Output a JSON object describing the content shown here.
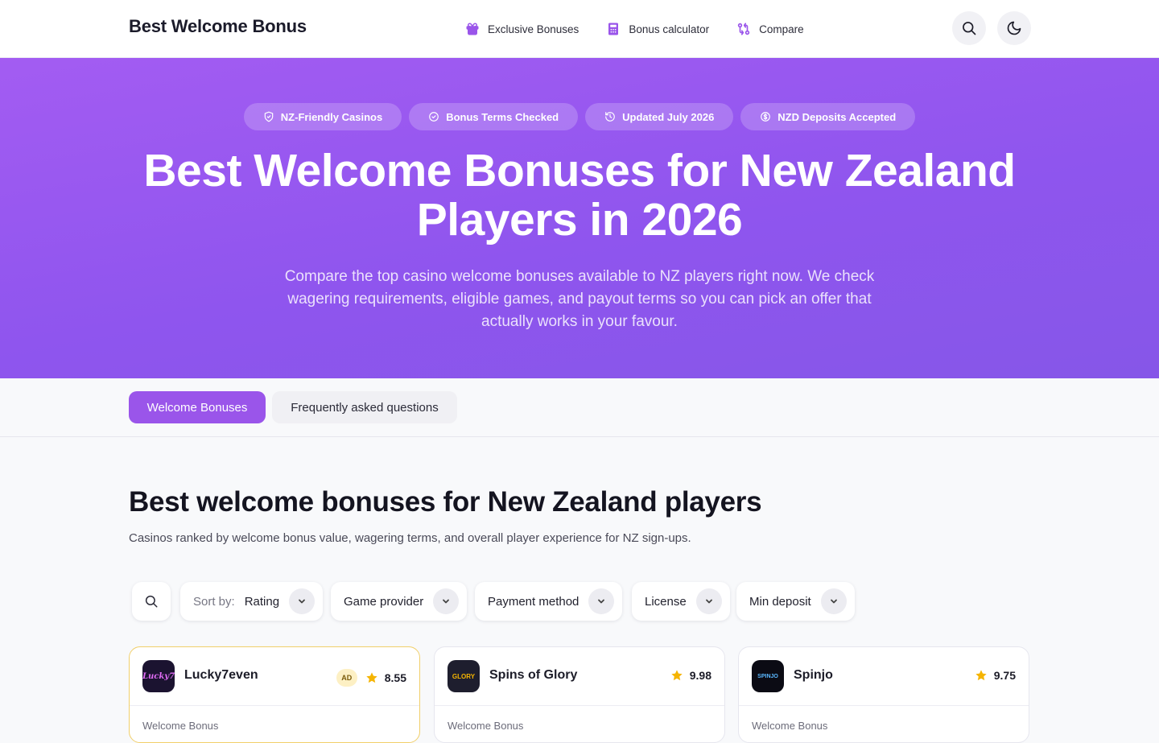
{
  "header": {
    "brand": "Best Welcome Bonus",
    "nav": [
      {
        "label": "Exclusive Bonuses",
        "icon": "gift-icon"
      },
      {
        "label": "Bonus calculator",
        "icon": "calculator-icon"
      },
      {
        "label": "Compare",
        "icon": "compare-icon"
      }
    ],
    "search_icon": "search-icon",
    "theme_icon": "moon-icon"
  },
  "hero": {
    "pills": [
      {
        "label": "NZ-Friendly Casinos",
        "icon": "shield-check-icon"
      },
      {
        "label": "Bonus Terms Checked",
        "icon": "badge-check-icon"
      },
      {
        "label": "Updated July 2026",
        "icon": "refresh-clock-icon"
      },
      {
        "label": "NZD Deposits Accepted",
        "icon": "dollar-circle-icon"
      }
    ],
    "title": "Best Welcome Bonuses for New Zealand Players in 2026",
    "subtitle": "Compare the top casino welcome bonuses available to NZ players right now. We check wagering requirements, eligible games, and payout terms so you can pick an offer that actually works in your favour."
  },
  "tabs": [
    {
      "label": "Welcome Bonuses",
      "active": true
    },
    {
      "label": "Frequently asked questions",
      "active": false
    }
  ],
  "section": {
    "title": "Best welcome bonuses for New Zealand players",
    "subtitle": "Casinos ranked by welcome bonus value, wagering terms, and overall player experience for NZ sign-ups."
  },
  "filters": {
    "sort_label": "Sort by:",
    "sort_value": "Rating",
    "items": [
      "Game provider",
      "Payment method",
      "License",
      "Min deposit"
    ]
  },
  "cards": [
    {
      "name": "Lucky7even",
      "rating": "8.55",
      "ad": "AD",
      "logo_text": "Lucky7",
      "label": "Welcome Bonus"
    },
    {
      "name": "Spins of Glory",
      "rating": "9.98",
      "logo_text": "GLORY",
      "label": "Welcome Bonus"
    },
    {
      "name": "Spinjo",
      "rating": "9.75",
      "logo_text": "SPINJO",
      "label": "Welcome Bonus"
    }
  ],
  "colors": {
    "accent": "#9a55ea",
    "hero_gradient_start": "#a35cf2",
    "hero_gradient_end": "#8656e8",
    "star": "#f5b400",
    "ad_border": "#f1cf6a"
  }
}
